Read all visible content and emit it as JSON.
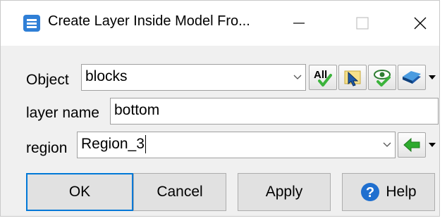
{
  "window": {
    "title": "Create Layer Inside Model Fro...",
    "controls": {
      "minimize": "minimize-icon",
      "maximize": "maximize-icon",
      "close": "close-icon"
    }
  },
  "object": {
    "label": "Object",
    "value": "blocks",
    "tools": [
      "select-all-icon",
      "pick-icon",
      "visibility-icon",
      "layer-menu-icon"
    ],
    "select_all_text": "All"
  },
  "layer_name": {
    "label": "layer name",
    "value": "bottom"
  },
  "region": {
    "label": "region",
    "value": "Region_3",
    "tools": [
      "back-arrow-icon"
    ]
  },
  "buttons": {
    "ok": "OK",
    "cancel": "Cancel",
    "apply": "Apply",
    "help": "Help"
  },
  "colors": {
    "accent": "#0078d7",
    "check_green": "#3bb33b",
    "help_blue": "#1f6fcf"
  }
}
